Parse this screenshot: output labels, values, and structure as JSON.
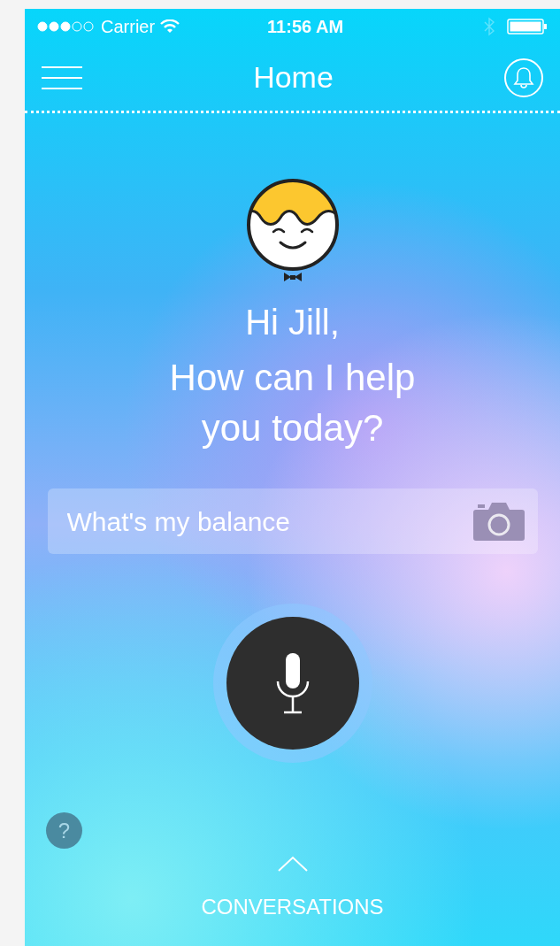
{
  "status_bar": {
    "carrier": "Carrier",
    "time": "11:56 AM"
  },
  "nav": {
    "title": "Home"
  },
  "greeting": "Hi Jill,",
  "prompt": "How can I help you today?",
  "query_field": {
    "value": "What's my balance"
  },
  "help_button": {
    "label": "?"
  },
  "footer": {
    "label": "CONVERSATIONS"
  }
}
